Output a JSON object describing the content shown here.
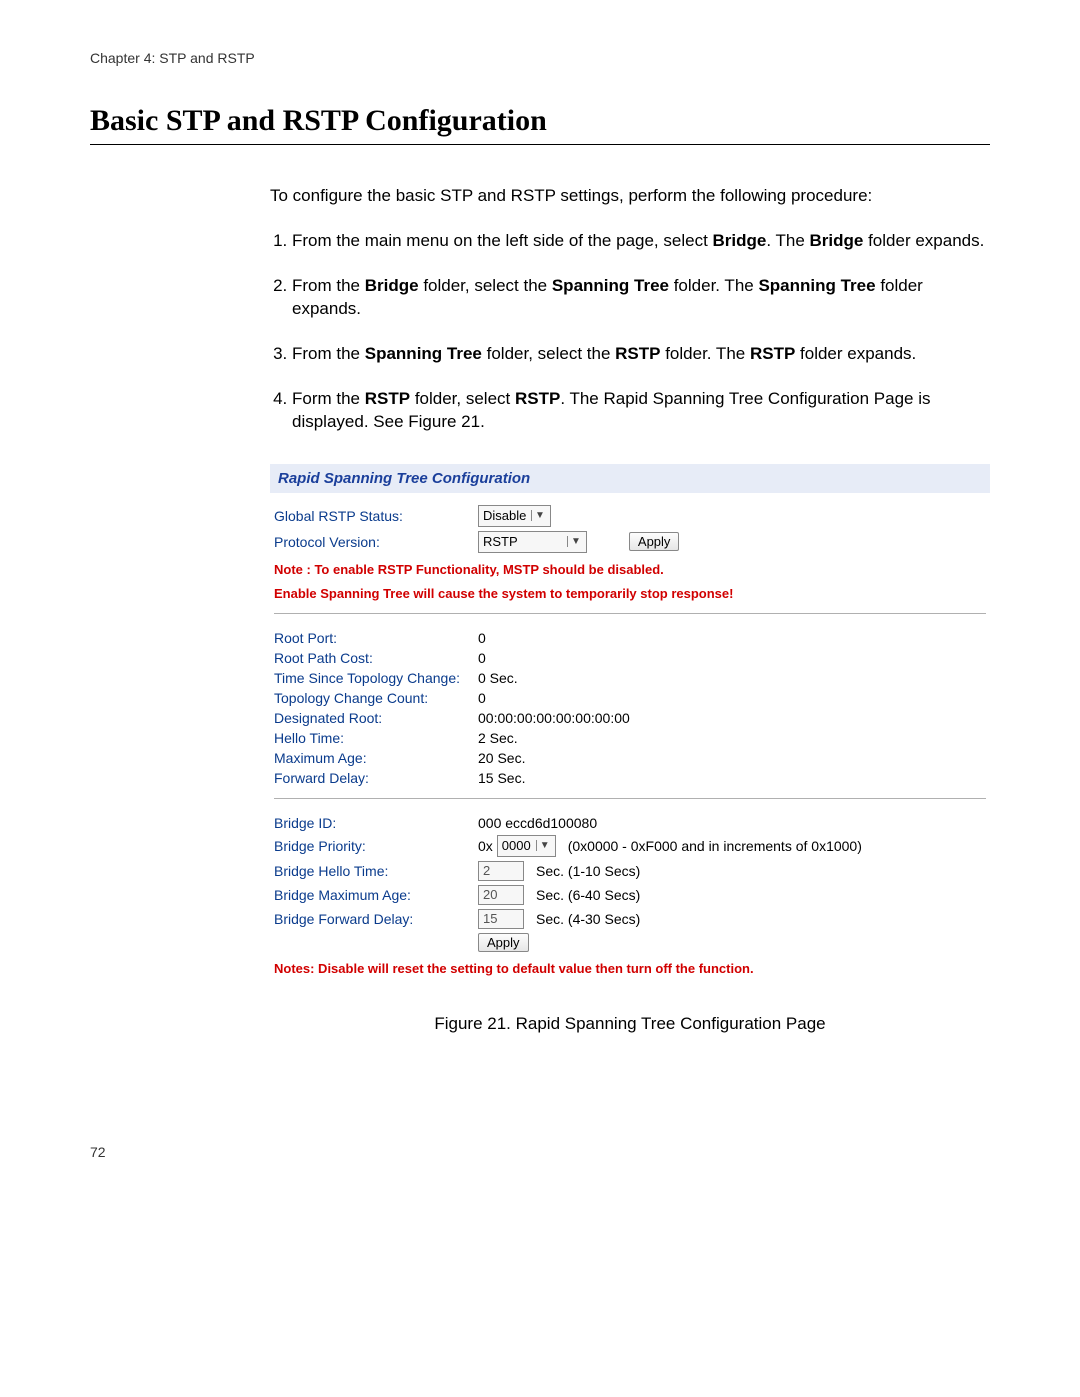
{
  "header": {
    "chapter": "Chapter 4: STP and RSTP"
  },
  "title": "Basic STP and RSTP Configuration",
  "intro": "To configure the basic STP and RSTP settings, perform the following procedure:",
  "steps": {
    "s1a": "From the main menu on the left side of the page, select ",
    "s1b": "Bridge",
    "s1c": ". The ",
    "s1d": "Bridge",
    "s1e": " folder expands.",
    "s2a": "From the ",
    "s2b": "Bridge",
    "s2c": " folder, select the ",
    "s2d": "Spanning Tree",
    "s2e": " folder. The ",
    "s2f": "Spanning Tree",
    "s2g": " folder expands.",
    "s3a": "From the ",
    "s3b": "Spanning Tree",
    "s3c": " folder, select the ",
    "s3d": "RSTP",
    "s3e": " folder. The ",
    "s3f": "RSTP",
    "s3g": " folder expands.",
    "s4a": "Form the ",
    "s4b": "RSTP",
    "s4c": " folder, select ",
    "s4d": "RSTP",
    "s4e": ". The Rapid Spanning Tree Configuration Page is displayed. See Figure 21."
  },
  "panel": {
    "title": "Rapid Spanning Tree Configuration",
    "globalStatus": {
      "label": "Global RSTP Status:",
      "value": "Disable"
    },
    "protocolVersion": {
      "label": "Protocol Version:",
      "value": "RSTP"
    },
    "applyTop": "Apply",
    "note1": "Note : To enable RSTP Functionality, MSTP should be disabled.",
    "note2": "Enable Spanning Tree will cause the system to temporarily stop response!",
    "rootPort": {
      "label": "Root Port:",
      "value": "0"
    },
    "rootPathCost": {
      "label": "Root Path Cost:",
      "value": "0"
    },
    "timeSince": {
      "label": "Time Since Topology Change:",
      "value": "0   Sec."
    },
    "topoCount": {
      "label": "Topology Change Count:",
      "value": "0"
    },
    "desigRoot": {
      "label": "Designated Root:",
      "value": "00:00:00:00:00:00:00:00"
    },
    "helloTime": {
      "label": "Hello Time:",
      "value": "2   Sec."
    },
    "maxAge": {
      "label": "Maximum Age:",
      "value": "20   Sec."
    },
    "fwdDelay": {
      "label": "Forward Delay:",
      "value": "15   Sec."
    },
    "bridgeId": {
      "label": "Bridge ID:",
      "value": "000 eccd6d100080"
    },
    "bridgePriority": {
      "label": "Bridge Priority:",
      "prefix": "0x",
      "value": "0000",
      "hint": "(0x0000 - 0xF000 and in increments of 0x1000)"
    },
    "bridgeHello": {
      "label": "Bridge Hello Time:",
      "value": "2",
      "hint": "Sec. (1-10 Secs)"
    },
    "bridgeMaxAge": {
      "label": "Bridge Maximum Age:",
      "value": "20",
      "hint": "Sec. (6-40 Secs)"
    },
    "bridgeFwd": {
      "label": "Bridge Forward Delay:",
      "value": "15",
      "hint": "Sec. (4-30 Secs)"
    },
    "applyBottom": "Apply",
    "note3": "Notes: Disable will reset the setting to default value then turn off the function."
  },
  "figureCaption": "Figure 21. Rapid Spanning Tree Configuration Page",
  "pageNumber": "72"
}
